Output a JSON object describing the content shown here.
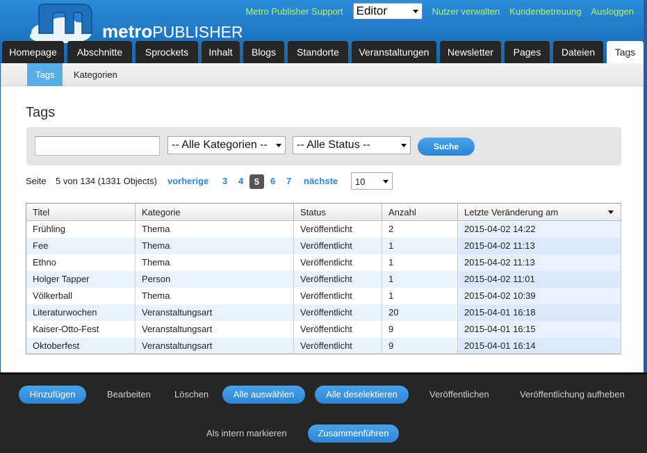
{
  "header": {
    "logo_text_bold": "metro",
    "logo_text_thin": "PUBLISHER",
    "support_link": "Metro Publisher Support",
    "role_select_value": "Editor",
    "links": [
      "Nutzer verwalten",
      "Kundenbetreuung",
      "Ausloggen"
    ]
  },
  "tabs": [
    "Homepage",
    "Abschnitte",
    "Sprockets",
    "Inhalt",
    "Blogs",
    "Standorte",
    "Veranstaltungen",
    "Newsletter",
    "Pages",
    "Dateien",
    "Tags"
  ],
  "active_tab": "Tags",
  "subtabs": [
    "Tags",
    "Kategorien"
  ],
  "page": {
    "title": "Tags"
  },
  "filters": {
    "search_value": "",
    "category_select": "-- Alle Kategorien --",
    "status_select": "-- Alle Status --",
    "search_button": "Suche"
  },
  "pager": {
    "label": "Seite",
    "info": "5 von 134 (1331 Objects)",
    "prev": "vorherige",
    "pages": [
      "3",
      "4",
      "5",
      "6",
      "7"
    ],
    "current": "5",
    "next": "nächste",
    "per_page": "10"
  },
  "table": {
    "columns": [
      "Titel",
      "Kategorie",
      "Status",
      "Anzahl",
      "Letzte Veränderung am"
    ],
    "rows": [
      [
        "Frühling",
        "Thema",
        "Veröffentlicht",
        "2",
        "2015-04-02 14:22"
      ],
      [
        "Fee",
        "Thema",
        "Veröffentlicht",
        "1",
        "2015-04-02 11:13"
      ],
      [
        "Ethno",
        "Thema",
        "Veröffentlicht",
        "1",
        "2015-04-02 11:13"
      ],
      [
        "Holger Tapper",
        "Person",
        "Veröffentlicht",
        "1",
        "2015-04-02 11:01"
      ],
      [
        "Völkerball",
        "Thema",
        "Veröffentlicht",
        "1",
        "2015-04-02 10:39"
      ],
      [
        "Literaturwochen",
        "Veranstaltungsart",
        "Veröffentlicht",
        "20",
        "2015-04-01 16:18"
      ],
      [
        "Kaiser-Otto-Fest",
        "Veranstaltungsart",
        "Veröffentlicht",
        "9",
        "2015-04-01 16:15"
      ],
      [
        "Oktoberfest",
        "Veranstaltungsart",
        "Veröffentlicht",
        "9",
        "2015-04-01 16:14"
      ]
    ]
  },
  "actions": {
    "add": "Hinzufügen",
    "edit": "Bearbeiten",
    "delete": "Löschen",
    "select_all": "Alle auswählen",
    "deselect_all": "Alle deselektieren",
    "publish": "Veröffentlichen",
    "unpublish": "Veröffentlichung aufheben",
    "mark_internal": "Als intern markieren",
    "merge": "Zusammenführen"
  },
  "colors": {
    "header_blue": "#1f74c2",
    "link_green": "#b7f25e",
    "accent_blue": "#2b86d6",
    "tab_dark": "#262626"
  }
}
